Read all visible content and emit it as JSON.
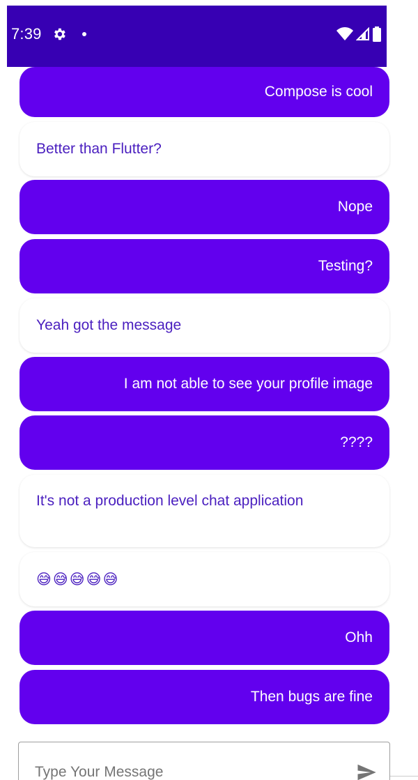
{
  "status_bar": {
    "time": "7:39",
    "background": "#3700b3",
    "icons": [
      "settings-gear-icon",
      "notification-dot-icon",
      "wifi-icon",
      "signal-icon",
      "battery-icon"
    ]
  },
  "colors": {
    "sent_bubble": "#6200ee",
    "received_text": "#4a1fbf",
    "received_bubble": "#ffffff"
  },
  "messages": [
    {
      "direction": "sent",
      "text": "Compose is cool"
    },
    {
      "direction": "received",
      "text": "Better than Flutter?"
    },
    {
      "direction": "sent",
      "text": "Nope"
    },
    {
      "direction": "sent",
      "text": "Testing?"
    },
    {
      "direction": "received",
      "text": "Yeah got the message"
    },
    {
      "direction": "sent",
      "text": "I am not able to see your profile image"
    },
    {
      "direction": "sent",
      "text": "????"
    },
    {
      "direction": "received",
      "text": "It's not a production level chat application"
    },
    {
      "direction": "received",
      "text": "😅😅😅😅😅"
    },
    {
      "direction": "sent",
      "text": "Ohh"
    },
    {
      "direction": "sent",
      "text": "Then bugs are fine"
    }
  ],
  "input": {
    "placeholder": "Type Your Message",
    "value": ""
  },
  "send_button": {
    "icon": "send-icon"
  }
}
